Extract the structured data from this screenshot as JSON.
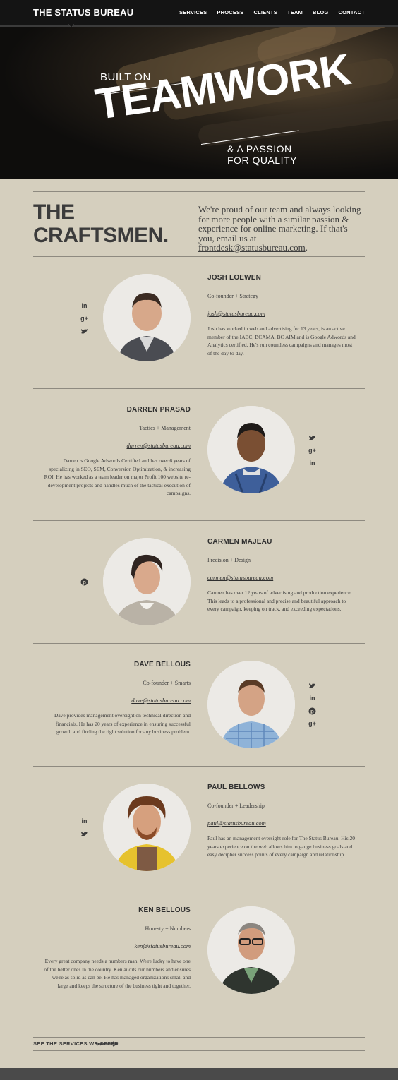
{
  "header": {
    "brand": "THE STATUS BUREAU",
    "nav": [
      "SERVICES",
      "PROCESS",
      "CLIENTS",
      "TEAM",
      "BLOG",
      "CONTACT"
    ]
  },
  "hero": {
    "line1": "BUILT ON",
    "line2": "TEAMWORK",
    "line3a": "& A PASSION",
    "line3b": "FOR QUALITY"
  },
  "intro": {
    "title_line1": "THE",
    "title_line2": "CRAFTSMEN.",
    "text": "We're proud of our team and always looking for more people with a similar passion & experience for online marketing. If that's you, email us at",
    "email": "frontdesk@statusbureau.com",
    "period": "."
  },
  "members": [
    {
      "name": "JOSH LOEWEN",
      "role": "Co-founder + Strategy",
      "email": "josh@statusbureau.com",
      "bio": "Josh has worked in web and advertising for 13 years, is an active member of the IABC, BCAMA, BC AIM and is Google Adwords and Analytics certified. He's run countless campaigns and manages most of the day to day.",
      "socials": [
        "linkedin-icon",
        "google-plus-icon",
        "twitter-icon"
      ]
    },
    {
      "name": "DARREN PRASAD",
      "role": "Tactics + Management",
      "email": "darren@statusbureau.com",
      "bio": "Darren is Google Adwords Certified and has over 6 years of specializing in SEO, SEM, Conversion Optimization, & increasing ROI. He has worked as a team leader on major Profit 100 website re-development projects and handles much of the tactical execution of campaigns.",
      "socials": [
        "twitter-icon",
        "google-plus-icon",
        "linkedin-icon"
      ]
    },
    {
      "name": "CARMEN MAJEAU",
      "role": "Precision + Design",
      "email": "carmen@statusbureau.com",
      "bio": "Carmen has over 12 years of advertising and production experience. This leads to a professional and precise and beautiful approach to every campaign, keeping on track, and exceeding expectations.",
      "socials": [
        "pinterest-icon"
      ]
    },
    {
      "name": "DAVE BELLOUS",
      "role": "Co-founder + Smarts",
      "email": "dave@statusbureau.com",
      "bio": "Dave provides management oversight on technical direction and financials. He has 20 years of experience in ensuring successful growth and finding the right solution for any business problem.",
      "socials": [
        "twitter-icon",
        "linkedin-icon",
        "pinterest-icon",
        "google-plus-icon"
      ]
    },
    {
      "name": "PAUL BELLOWS",
      "role": "Co-founder + Leadership",
      "email": "paul@statusbureau.com",
      "bio": "Paul has an management oversight role for The Status Bureau. His 20 years experience on the web allows him to gauge business goals and easy decipher success points of every campaign and relationship.",
      "socials": [
        "linkedin-icon",
        "twitter-icon"
      ]
    },
    {
      "name": "KEN BELLOUS",
      "role": "Honesty + Numbers",
      "email": "ken@statusbureau.com",
      "bio": "Every great company needs a numbers man. We're lucky to have one of the better ones in the country. Ken audits our numbers and ensures we're as solid as can be. He has managed organizations small and large and keeps the structure of the business tight and together.",
      "socials": []
    }
  ],
  "footer": {
    "link": "SEE THE SERVICES WE OFFER"
  },
  "colors": {
    "background": "#d5cfbe",
    "header": "#141414",
    "text": "#3d3d3d"
  }
}
